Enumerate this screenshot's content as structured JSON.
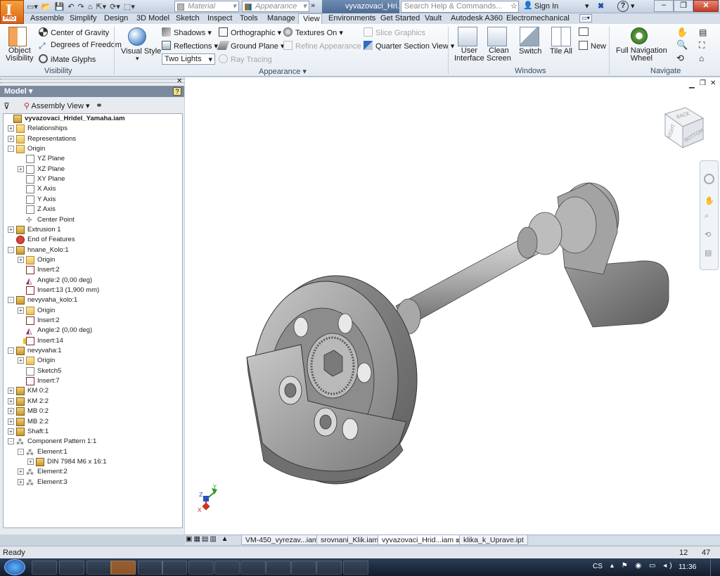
{
  "app": {
    "logo_letter": "I",
    "logo_edition": "PRO",
    "document_title": "vyvazovaci_Hri...",
    "search_placeholder": "Search Help & Commands...",
    "sign_in": "Sign In",
    "help": "?"
  },
  "quick_access": {
    "material": "Material",
    "appearance": "Appearance"
  },
  "ribbon_tabs": [
    "Assemble",
    "Simplify",
    "Design",
    "3D Model",
    "Sketch",
    "Inspect",
    "Tools",
    "Manage",
    "View",
    "Environments",
    "Get Started",
    "Vault",
    "Autodesk A360",
    "Electromechanical"
  ],
  "active_tab": "View",
  "ribbon": {
    "visibility": {
      "title": "Visibility",
      "object_visibility": "Object\nVisibility",
      "center_of_gravity": "Center of Gravity",
      "degrees_of_freedom": "Degrees of Freedom",
      "imate_glyphs": "iMate Glyphs"
    },
    "appearance": {
      "title": "Appearance",
      "visual_style": "Visual Style",
      "shadows": "Shadows",
      "reflections": "Reflections",
      "lighting_select": "Two Lights",
      "orthographic": "Orthographic",
      "ground_plane": "Ground Plane",
      "ray_tracing": "Ray Tracing",
      "textures_on": "Textures On",
      "refine_appearance": "Refine Appearance",
      "slice_graphics": "Slice Graphics",
      "quarter_section_view": "Quarter Section View"
    },
    "windows": {
      "title": "Windows",
      "user_interface": "User\nInterface",
      "clean_screen": "Clean\nScreen",
      "switch": "Switch",
      "tile_all": "Tile All",
      "new": "New"
    },
    "navigate": {
      "title": "Navigate",
      "full_navigation_wheel": "Full Navigation\nWheel"
    }
  },
  "browser": {
    "header": "Model",
    "view_select": "Assembly View",
    "tree": [
      {
        "label": "vyvazovaci_Hridel_Yamaha.iam",
        "depth": 0,
        "icon": "assembly",
        "bold": true,
        "expander": ""
      },
      {
        "label": "Relationships",
        "depth": 1,
        "icon": "folder",
        "expander": "+"
      },
      {
        "label": "Representations",
        "depth": 1,
        "icon": "folder",
        "expander": "+"
      },
      {
        "label": "Origin",
        "depth": 1,
        "icon": "folder",
        "expander": "-"
      },
      {
        "label": "YZ Plane",
        "depth": 2,
        "icon": "plane",
        "expander": ""
      },
      {
        "label": "XZ Plane",
        "depth": 2,
        "icon": "plane",
        "expander": "+"
      },
      {
        "label": "XY Plane",
        "depth": 2,
        "icon": "plane",
        "expander": ""
      },
      {
        "label": "X Axis",
        "depth": 2,
        "icon": "axis",
        "expander": ""
      },
      {
        "label": "Y Axis",
        "depth": 2,
        "icon": "axis",
        "expander": ""
      },
      {
        "label": "Z Axis",
        "depth": 2,
        "icon": "axis",
        "expander": ""
      },
      {
        "label": "Center Point",
        "depth": 2,
        "icon": "point",
        "expander": ""
      },
      {
        "label": "Extrusion 1",
        "depth": 1,
        "icon": "extrusion",
        "expander": "+"
      },
      {
        "label": "End of Features",
        "depth": 1,
        "icon": "end",
        "expander": ""
      },
      {
        "label": "hnane_Kolo:1",
        "depth": 1,
        "icon": "part",
        "expander": "-"
      },
      {
        "label": "Origin",
        "depth": 2,
        "icon": "folder",
        "expander": "+"
      },
      {
        "label": "Insert:2",
        "depth": 2,
        "icon": "constraint",
        "expander": ""
      },
      {
        "label": "Angle:2 (0,00 deg)",
        "depth": 2,
        "icon": "angle",
        "expander": ""
      },
      {
        "label": "Insert:13 (1,900 mm)",
        "depth": 2,
        "icon": "constraint",
        "expander": ""
      },
      {
        "label": "nevyvaha_kolo:1",
        "depth": 1,
        "icon": "part",
        "expander": "-"
      },
      {
        "label": "Origin",
        "depth": 2,
        "icon": "folder",
        "expander": "+"
      },
      {
        "label": "Insert:2",
        "depth": 2,
        "icon": "constraint",
        "expander": ""
      },
      {
        "label": "Angle:2 (0,00 deg)",
        "depth": 2,
        "icon": "angle",
        "expander": ""
      },
      {
        "label": "Insert:14",
        "depth": 2,
        "icon": "constraint-warn",
        "expander": ""
      },
      {
        "label": "nevyvaha:1",
        "depth": 1,
        "icon": "part",
        "expander": "-"
      },
      {
        "label": "Origin",
        "depth": 2,
        "icon": "folder",
        "expander": "+"
      },
      {
        "label": "Sketch5",
        "depth": 2,
        "icon": "sketch",
        "expander": ""
      },
      {
        "label": "Insert:7",
        "depth": 2,
        "icon": "constraint",
        "expander": ""
      },
      {
        "label": "KM 0:2",
        "depth": 1,
        "icon": "part",
        "expander": "+"
      },
      {
        "label": "KM 2:2",
        "depth": 1,
        "icon": "part",
        "expander": "+"
      },
      {
        "label": "MB 0:2",
        "depth": 1,
        "icon": "part",
        "expander": "+"
      },
      {
        "label": "MB 2:2",
        "depth": 1,
        "icon": "part",
        "expander": "+"
      },
      {
        "label": "Shaft:1",
        "depth": 1,
        "icon": "shaft",
        "expander": "+"
      },
      {
        "label": "Component Pattern 1:1",
        "depth": 1,
        "icon": "pattern",
        "expander": "-"
      },
      {
        "label": "Element:1",
        "depth": 2,
        "icon": "element",
        "expander": "-"
      },
      {
        "label": "DIN 7984 M6 x 16:1",
        "depth": 3,
        "icon": "bolt",
        "expander": "+"
      },
      {
        "label": "Element:2",
        "depth": 2,
        "icon": "element",
        "expander": "+"
      },
      {
        "label": "Element:3",
        "depth": 2,
        "icon": "element",
        "expander": "+"
      }
    ]
  },
  "viewcube": {
    "top": "BACK",
    "left": "RIGHT",
    "right": "BOTTOM"
  },
  "triad": {
    "x": "X",
    "y": "Y",
    "z": "Z"
  },
  "doc_tabs": [
    "VM-450_vyrezav...iam",
    "srovnani_Klik.iam",
    "vyvazovaci_Hrid...iam",
    "klika_k_Uprave.ipt"
  ],
  "active_doc_tab": 2,
  "status": {
    "text": "Ready",
    "num1": "12",
    "num2": "47"
  },
  "taskbar": {
    "language": "CS",
    "clock": "11:36"
  },
  "colors": {
    "accent": "#e07a22",
    "part_gray": "#8e8e8e"
  }
}
